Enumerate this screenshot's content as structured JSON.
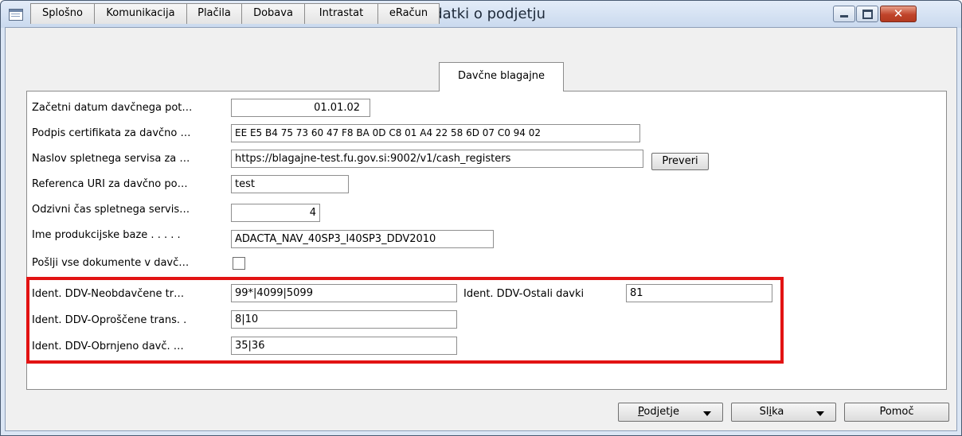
{
  "window": {
    "title": "Podatki o podjetju"
  },
  "tabs": [
    {
      "label": "Splošno"
    },
    {
      "label": "Komunikacija"
    },
    {
      "label": "Plačila"
    },
    {
      "label": "Dobava"
    },
    {
      "label": "Intrastat"
    },
    {
      "label": "eRačun"
    },
    {
      "label": "Davčne blagajne"
    }
  ],
  "active_tab": "Davčne blagajne",
  "form": {
    "start_date": {
      "label": "Začetni datum davčnega pot…",
      "value": "01.01.02"
    },
    "cert_signature": {
      "label": "Podpis certifikata za davčno …",
      "value": "EE E5 B4 75 73 60 47 F8 BA 0D C8 01 A4 22 58 6D 07 C0 94 02"
    },
    "service_url": {
      "label": "Naslov spletnega servisa za …",
      "value": "https://blagajne-test.fu.gov.si:9002/v1/cash_registers",
      "check_button": "Preveri"
    },
    "uri_reference": {
      "label": "Referenca URI za davčno po…",
      "value": "test"
    },
    "response_time": {
      "label": "Odzivni čas spletnega servis…",
      "value": "4"
    },
    "production_db": {
      "label": "Ime produkcijske baze . . . . .",
      "value": "ADACTA_NAV_40SP3_I40SP3_DDV2010"
    },
    "send_all": {
      "label": "Pošlji vse dokumente v davč…",
      "checked": false
    },
    "vat_untaxed": {
      "label": "Ident. DDV-Neobdavčene tr…",
      "value": "99*|4099|5099"
    },
    "vat_other": {
      "label": "Ident. DDV-Ostali davki",
      "value": "81"
    },
    "vat_exempt": {
      "label": "Ident. DDV-Oproščene trans. .",
      "value": "8|10"
    },
    "vat_reverse": {
      "label": "Ident. DDV-Obrnjeno davč. …",
      "value": "35|36"
    }
  },
  "footer": {
    "company_button": {
      "prefix": "P",
      "rest": "odjetje"
    },
    "image_button": {
      "prefix": "Sl",
      "u": "i",
      "rest": "ka"
    },
    "help_button": "Pomoč"
  },
  "colors": {
    "highlight": "#e21313",
    "titlebar": "#c9d9ee",
    "close_button": "#c0432a"
  }
}
